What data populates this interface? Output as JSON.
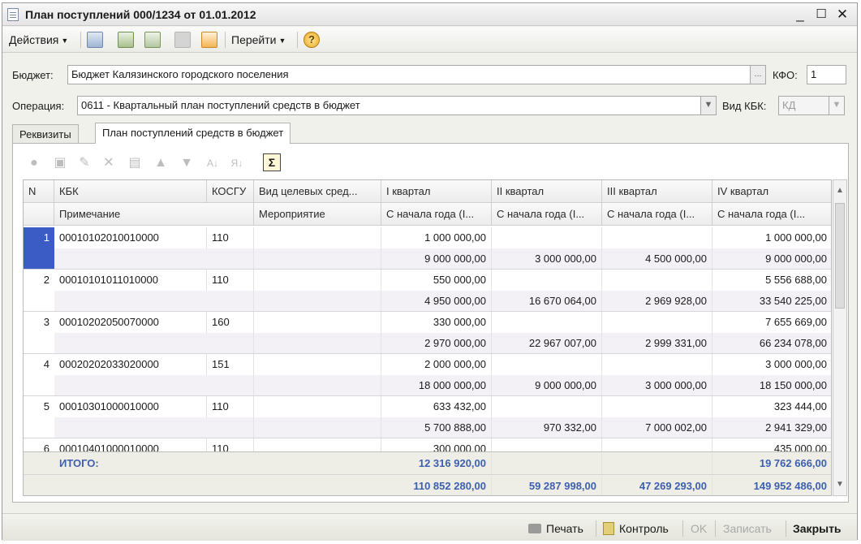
{
  "window": {
    "title": "План поступлений 000/1234 от 01.01.2012"
  },
  "toolbar": {
    "actions_label": "Действия",
    "goto_label": "Перейти"
  },
  "form": {
    "budget_label": "Бюджет:",
    "budget_value": "Бюджет Калязинского городского поселения",
    "kfo_label": "КФО:",
    "kfo_value": "1",
    "operation_label": "Операция:",
    "operation_value": "0611 - Квартальный план поступлений средств в бюджет",
    "kbk_type_label": "Вид КБК:",
    "kbk_type_value": "КД"
  },
  "tabs": [
    "Реквизиты",
    "План поступлений средств в бюджет"
  ],
  "table": {
    "headers_row1": [
      "N",
      "КБК",
      "КОСГУ",
      "Вид целевых сред...",
      "I квартал",
      "II квартал",
      "III квартал",
      "IV квартал"
    ],
    "headers_row2": [
      "Примечание",
      "Мероприятие",
      "С начала года (I...",
      "С начала года (I...",
      "С начала года (I...",
      "С начала года (I..."
    ],
    "rows": [
      {
        "n": "1",
        "kbk": "00010102010010000",
        "kosgu": "110",
        "q1": "1 000 000,00",
        "q2": "",
        "q3": "",
        "q4": "1 000 000,00",
        "c1": "9 000 000,00",
        "c2": "3 000 000,00",
        "c3": "4 500 000,00",
        "c4": "9 000 000,00"
      },
      {
        "n": "2",
        "kbk": "00010101011010000",
        "kosgu": "110",
        "q1": "550 000,00",
        "q2": "",
        "q3": "",
        "q4": "5 556 688,00",
        "c1": "4 950 000,00",
        "c2": "16 670 064,00",
        "c3": "2 969 928,00",
        "c4": "33 540 225,00"
      },
      {
        "n": "3",
        "kbk": "00010202050070000",
        "kosgu": "160",
        "q1": "330 000,00",
        "q2": "",
        "q3": "",
        "q4": "7 655 669,00",
        "c1": "2 970 000,00",
        "c2": "22 967 007,00",
        "c3": "2 999 331,00",
        "c4": "66 234 078,00"
      },
      {
        "n": "4",
        "kbk": "00020202033020000",
        "kosgu": "151",
        "q1": "2 000 000,00",
        "q2": "",
        "q3": "",
        "q4": "3 000 000,00",
        "c1": "18 000 000,00",
        "c2": "9 000 000,00",
        "c3": "3 000 000,00",
        "c4": "18 150 000,00"
      },
      {
        "n": "5",
        "kbk": "00010301000010000",
        "kosgu": "110",
        "q1": "633 432,00",
        "q2": "",
        "q3": "",
        "q4": "323 444,00",
        "c1": "5 700 888,00",
        "c2": "970 332,00",
        "c3": "7 000 002,00",
        "c4": "2 941 329,00"
      },
      {
        "n": "6",
        "kbk": "00010401000010000",
        "kosgu": "110",
        "q1": "300 000,00",
        "q2": "",
        "q3": "",
        "q4": "435 000,00",
        "c1": "",
        "c2": "",
        "c3": "",
        "c4": ""
      }
    ],
    "totals": {
      "label": "ИТОГО:",
      "q1": "12 316 920,00",
      "q2": "",
      "q3": "",
      "q4": "19 762 666,00",
      "c1": "110 852 280,00",
      "c2": "59 287 998,00",
      "c3": "47 269 293,00",
      "c4": "149 952 486,00"
    }
  },
  "bottom": {
    "print": "Печать",
    "control": "Контроль",
    "ok": "OK",
    "save": "Записать",
    "close": "Закрыть"
  },
  "colors": {
    "total_text": "#3d5fae",
    "selected_row_marker": "#3b5cc4",
    "alt_row": "#f3f0f6"
  }
}
